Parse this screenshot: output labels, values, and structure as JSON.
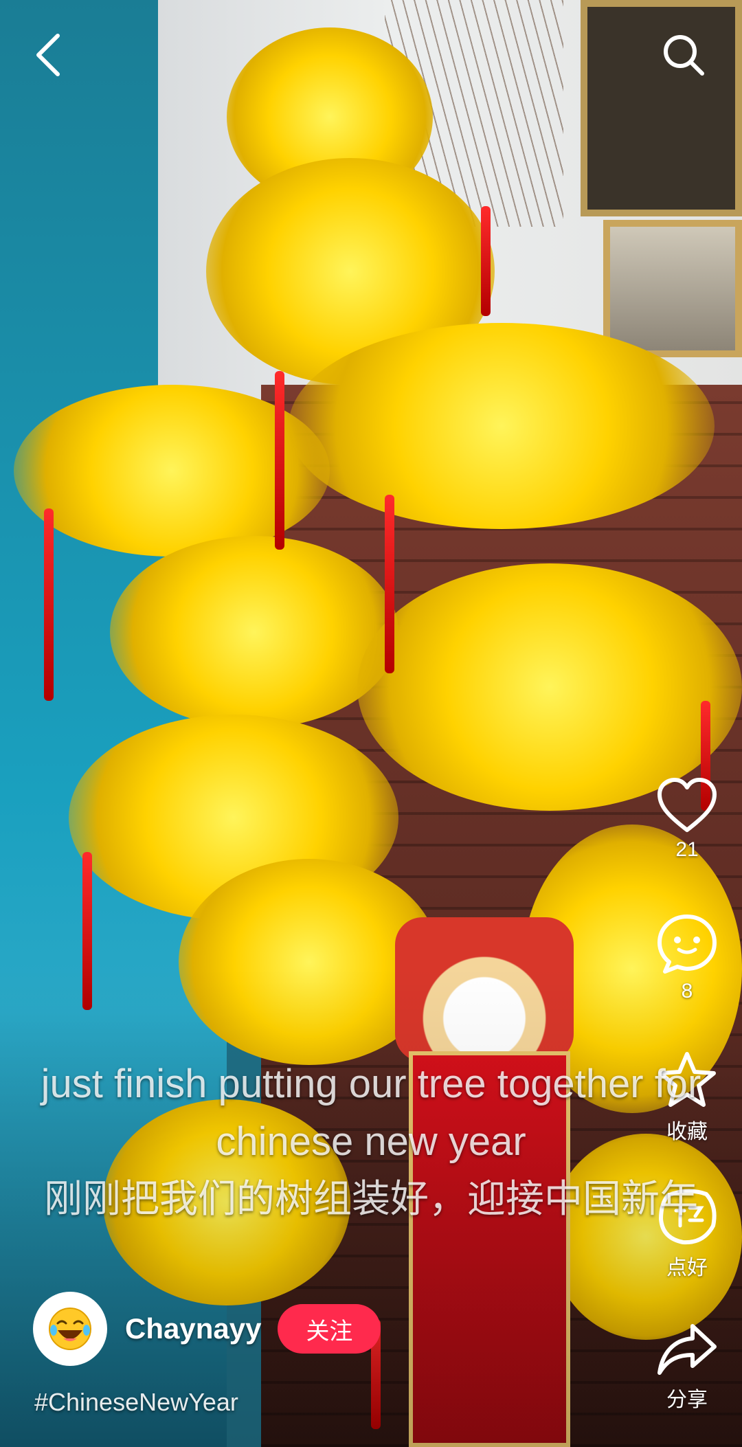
{
  "nav": {
    "back_icon": "chevron-left-icon",
    "search_icon": "search-icon"
  },
  "actions": {
    "like": {
      "icon": "heart-icon",
      "count": "21"
    },
    "comment": {
      "icon": "comment-icon",
      "count": "8"
    },
    "favorite": {
      "icon": "star-icon",
      "label": "收藏"
    },
    "good": {
      "icon": "good-stamp-icon",
      "label": "点好"
    },
    "share": {
      "icon": "share-arrow-icon",
      "label": "分享"
    }
  },
  "caption": {
    "english": "just finish putting our tree together for chinese new year",
    "chinese": "刚刚把我们的树组装好，迎接中国新年"
  },
  "author": {
    "name": "Chaynayy",
    "avatar_icon": "laughing-emoji-avatar",
    "follow_label": "关注"
  },
  "hashtag": "#ChineseNewYear",
  "colors": {
    "follow_button": "#ff2a4d",
    "icon": "#ffffff"
  }
}
